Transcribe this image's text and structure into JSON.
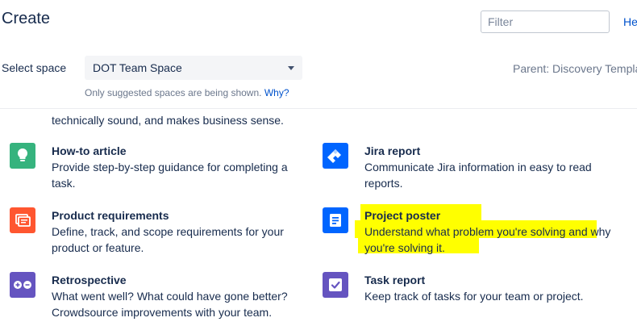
{
  "header": {
    "title": "Create",
    "filter_placeholder": "Filter",
    "help_label": "He"
  },
  "space": {
    "label": "Select space",
    "selected": "DOT Team Space",
    "note_text": "Only suggested spaces are being shown.",
    "note_link": "Why?",
    "parent_text": "Parent: Discovery Templat"
  },
  "cut_description": "technically sound, and makes business sense.",
  "templates": [
    {
      "name": "How-to article",
      "description": "Provide step-by-step guidance for completing a task.",
      "icon": "lightbulb-icon",
      "color": "#36b37e"
    },
    {
      "name": "Jira report",
      "description": "Communicate Jira information in easy to read reports.",
      "icon": "jira-icon",
      "color": "#0065ff"
    },
    {
      "name": "Product requirements",
      "description": "Define, track, and scope requirements for your product or feature.",
      "icon": "requirements-icon",
      "color": "#ff5630"
    },
    {
      "name": "Project poster",
      "description": "Understand what problem you're solving and why you're solving it.",
      "icon": "poster-icon",
      "color": "#0065ff",
      "highlighted": true
    },
    {
      "name": "Retrospective",
      "description": "What went well? What could have gone better? Crowdsource improvements with your team.",
      "icon": "retrospective-icon",
      "color": "#6554c0"
    },
    {
      "name": "Task report",
      "description": "Keep track of tasks for your team or project.",
      "icon": "task-icon",
      "color": "#6554c0"
    }
  ],
  "colors": {
    "highlight": "#ffff00",
    "link": "#0052cc"
  }
}
